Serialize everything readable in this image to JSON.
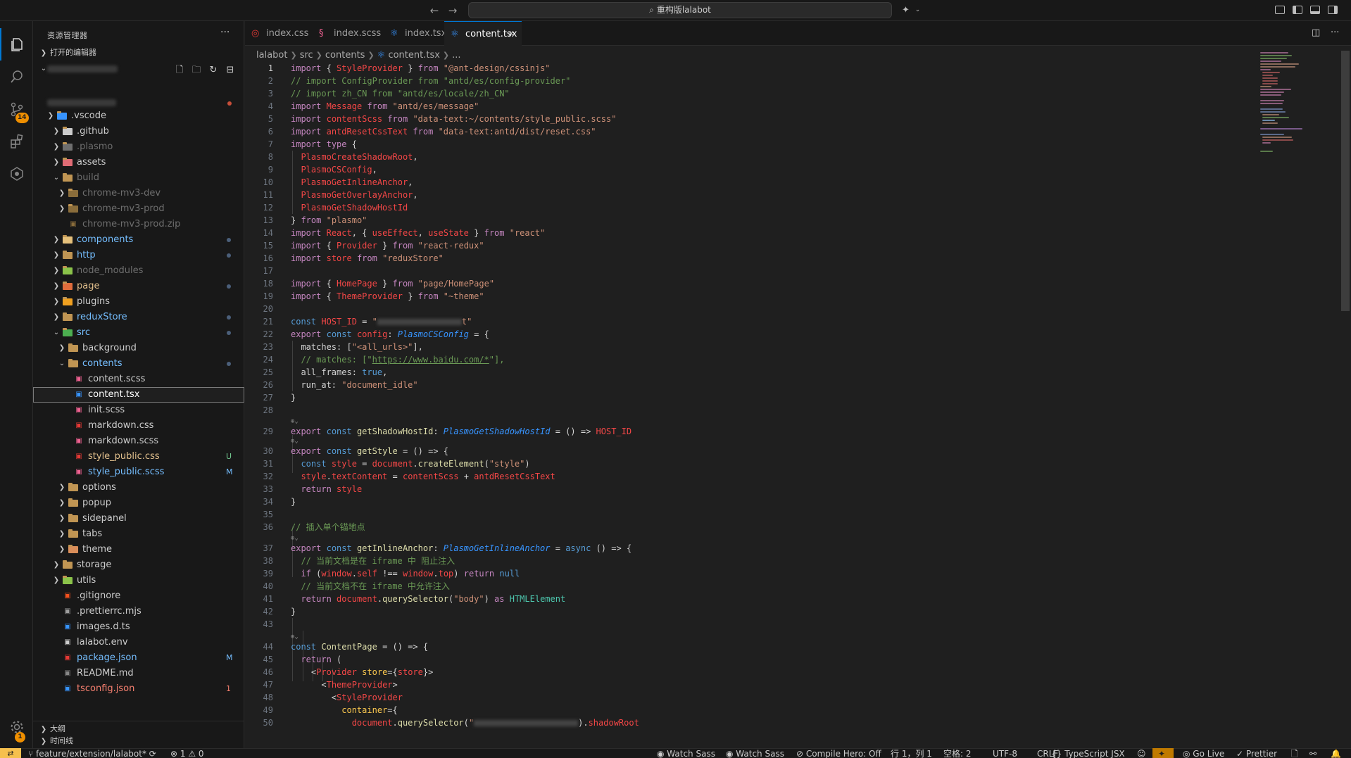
{
  "titlebar": {
    "back_arrow": "←",
    "forward_arrow": "→",
    "search_text": "重构版lalabot",
    "search_icon": "search-icon",
    "copilot_icon": "copilot-icon",
    "layout_icons": [
      "customize-layout-icon",
      "toggle-primary-sidebar-icon",
      "toggle-panel-icon",
      "toggle-secondary-sidebar-icon"
    ]
  },
  "activitybar": {
    "items": [
      "explorer-icon",
      "search-icon",
      "source-control-icon",
      "extensions-icon",
      "remote-explorer-icon"
    ],
    "source_control_badge": "14",
    "accounts_badge": "1"
  },
  "sidebar": {
    "title": "资源管理器",
    "more": "···",
    "open_editors": "打开的编辑器",
    "outline": "大纲",
    "timeline": "时间线",
    "tree": [
      {
        "label": ".vscode",
        "depth": 1,
        "type": "folder",
        "open": false,
        "color": "#cccccc",
        "icon_color": "#3794ff"
      },
      {
        "label": ".github",
        "depth": 2,
        "type": "folder",
        "open": false,
        "color": "#cccccc",
        "icon_color": "#cccccc"
      },
      {
        "label": ".plasmo",
        "depth": 2,
        "type": "folder",
        "open": false,
        "color": "#6e6e6e",
        "icon_color": "#6e6e6e"
      },
      {
        "label": "assets",
        "depth": 2,
        "type": "folder",
        "open": false,
        "color": "#cccccc",
        "icon_color": "#e06c75"
      },
      {
        "label": "build",
        "depth": 2,
        "type": "folder",
        "open": true,
        "color": "#6e6e6e",
        "icon_color": "#c09553"
      },
      {
        "label": "chrome-mv3-dev",
        "depth": 3,
        "type": "folder",
        "open": false,
        "color": "#6e6e6e",
        "icon_color": "#8a6d3b"
      },
      {
        "label": "chrome-mv3-prod",
        "depth": 3,
        "type": "folder",
        "open": false,
        "color": "#6e6e6e",
        "icon_color": "#8a6d3b"
      },
      {
        "label": "chrome-mv3-prod.zip",
        "depth": 3,
        "type": "file",
        "color": "#6e6e6e",
        "icon_color": "#8a6d3b"
      },
      {
        "label": "components",
        "depth": 2,
        "type": "folder",
        "open": false,
        "color": "#75beff",
        "icon_color": "#e5c07b"
      },
      {
        "label": "http",
        "depth": 2,
        "type": "folder",
        "open": false,
        "color": "#75beff",
        "icon_color": "#c09553"
      },
      {
        "label": "node_modules",
        "depth": 2,
        "type": "folder",
        "open": false,
        "color": "#6e6e6e",
        "icon_color": "#8bc34a"
      },
      {
        "label": "page",
        "depth": 2,
        "type": "folder",
        "open": false,
        "color": "#e2c08d",
        "icon_color": "#e06c3c"
      },
      {
        "label": "plugins",
        "depth": 2,
        "type": "folder",
        "open": false,
        "color": "#cccccc",
        "icon_color": "#f0a020"
      },
      {
        "label": "reduxStore",
        "depth": 2,
        "type": "folder",
        "open": false,
        "color": "#75beff",
        "icon_color": "#c09553"
      },
      {
        "label": "src",
        "depth": 2,
        "type": "folder",
        "open": true,
        "color": "#75beff",
        "icon_color": "#4caf50"
      },
      {
        "label": "background",
        "depth": 3,
        "type": "folder",
        "open": false,
        "color": "#cccccc",
        "icon_color": "#c09553"
      },
      {
        "label": "contents",
        "depth": 3,
        "type": "folder",
        "open": true,
        "color": "#75beff",
        "icon_color": "#c09553"
      },
      {
        "label": "content.scss",
        "depth": 4,
        "type": "file",
        "color": "#cccccc",
        "icon_color": "#f06292"
      },
      {
        "label": "content.tsx",
        "depth": 4,
        "type": "file",
        "color": "#ffffff",
        "icon_color": "#3794ff",
        "selected": true
      },
      {
        "label": "init.scss",
        "depth": 4,
        "type": "file",
        "color": "#cccccc",
        "icon_color": "#f06292"
      },
      {
        "label": "markdown.css",
        "depth": 4,
        "type": "file",
        "color": "#cccccc",
        "icon_color": "#e53935"
      },
      {
        "label": "markdown.scss",
        "depth": 4,
        "type": "file",
        "color": "#cccccc",
        "icon_color": "#f06292"
      },
      {
        "label": "style_public.css",
        "depth": 4,
        "type": "file",
        "color": "#e2c08d",
        "icon_color": "#e53935",
        "deco": "U",
        "deco_color": "#73c991"
      },
      {
        "label": "style_public.scss",
        "depth": 4,
        "type": "file",
        "color": "#75beff",
        "icon_color": "#f06292",
        "deco": "M",
        "deco_color": "#75beff"
      },
      {
        "label": "options",
        "depth": 3,
        "type": "folder",
        "open": false,
        "color": "#cccccc",
        "icon_color": "#c09553"
      },
      {
        "label": "popup",
        "depth": 3,
        "type": "folder",
        "open": false,
        "color": "#cccccc",
        "icon_color": "#c09553"
      },
      {
        "label": "sidepanel",
        "depth": 3,
        "type": "folder",
        "open": false,
        "color": "#cccccc",
        "icon_color": "#c09553"
      },
      {
        "label": "tabs",
        "depth": 3,
        "type": "folder",
        "open": false,
        "color": "#cccccc",
        "icon_color": "#c09553"
      },
      {
        "label": "theme",
        "depth": 3,
        "type": "folder",
        "open": false,
        "color": "#cccccc",
        "icon_color": "#d98e5a"
      },
      {
        "label": "storage",
        "depth": 2,
        "type": "folder",
        "open": false,
        "color": "#cccccc",
        "icon_color": "#c09553"
      },
      {
        "label": "utils",
        "depth": 2,
        "type": "folder",
        "open": false,
        "color": "#cccccc",
        "icon_color": "#8bc34a"
      },
      {
        "label": ".gitignore",
        "depth": 2,
        "type": "file",
        "color": "#cccccc",
        "icon_color": "#f4511e"
      },
      {
        "label": ".prettierrc.mjs",
        "depth": 2,
        "type": "file",
        "color": "#cccccc",
        "icon_color": "#9e9e9e"
      },
      {
        "label": "images.d.ts",
        "depth": 2,
        "type": "file",
        "color": "#cccccc",
        "icon_color": "#3794ff"
      },
      {
        "label": "lalabot.env",
        "depth": 2,
        "type": "file",
        "color": "#cccccc",
        "icon_color": "#cccccc"
      },
      {
        "label": "package.json",
        "depth": 2,
        "type": "file",
        "color": "#75beff",
        "icon_color": "#e53935",
        "deco": "M",
        "deco_color": "#75beff"
      },
      {
        "label": "README.md",
        "depth": 2,
        "type": "file",
        "color": "#cccccc",
        "icon_color": "#888888"
      },
      {
        "label": "tsconfig.json",
        "depth": 2,
        "type": "file",
        "color": "#f88070",
        "icon_color": "#3794ff",
        "deco": "1",
        "deco_color": "#f88070"
      }
    ]
  },
  "tabs": [
    {
      "label": "index.css",
      "icon": "css-file-icon",
      "icon_color": "#e53935"
    },
    {
      "label": "index.scss",
      "icon": "scss-file-icon",
      "icon_color": "#f06292"
    },
    {
      "label": "index.tsx",
      "icon": "react-file-icon",
      "icon_color": "#3794ff"
    },
    {
      "label": "content.tsx",
      "icon": "react-file-icon",
      "icon_color": "#3794ff",
      "active": true
    }
  ],
  "breadcrumb": [
    "lalabot",
    "src",
    "contents",
    "content.tsx",
    "..."
  ],
  "code_lines": [
    "1",
    "2",
    "3",
    "4",
    "5",
    "6",
    "7",
    "8",
    "9",
    "10",
    "11",
    "12",
    "13",
    "14",
    "15",
    "16",
    "17",
    "18",
    "19",
    "20",
    "21",
    "22",
    "23",
    "24",
    "25",
    "26",
    "27",
    "28",
    "29",
    "30",
    "31",
    "32",
    "33",
    "34",
    "35",
    "36",
    "37",
    "38",
    "39",
    "40",
    "41",
    "42",
    "43",
    "44",
    "45",
    "46",
    "47",
    "48",
    "49",
    "50"
  ],
  "statusbar": {
    "branch": "feature/extension/lalabot*",
    "problems": "⊗ 1 ⚠ 0",
    "watch_sass_1": "Watch Sass",
    "watch_sass_2": "Watch Sass",
    "compile_hero": "Compile Hero: Off",
    "position": "行 1，列 1",
    "spaces": "空格: 2",
    "encoding": "UTF-8",
    "eol": "CRLF",
    "language": "TypeScript JSX",
    "go_live": "Go Live",
    "prettier": "Prettier"
  }
}
